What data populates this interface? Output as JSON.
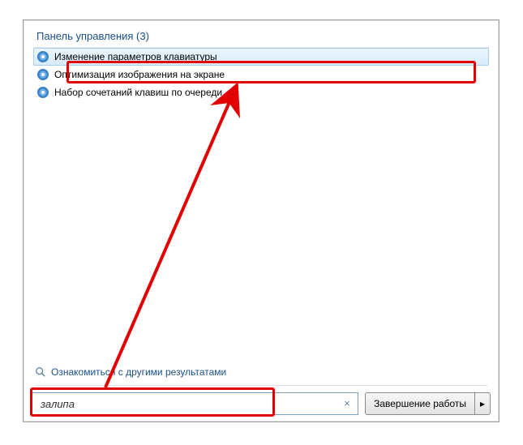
{
  "category": {
    "label": "Панель управления (3)"
  },
  "results": [
    {
      "label": "Изменение параметров клавиатуры",
      "selected": true
    },
    {
      "label": "Оптимизация изображения на экране",
      "selected": false
    },
    {
      "label": "Набор сочетаний клавиш по очереди",
      "selected": false
    }
  ],
  "more_results_label": "Ознакомиться с другими результатами",
  "search": {
    "value": "залипа",
    "clear_glyph": "×"
  },
  "shutdown": {
    "label": "Завершение работы",
    "arrow_glyph": "▸"
  },
  "annotation": {
    "color": "#e30000"
  }
}
